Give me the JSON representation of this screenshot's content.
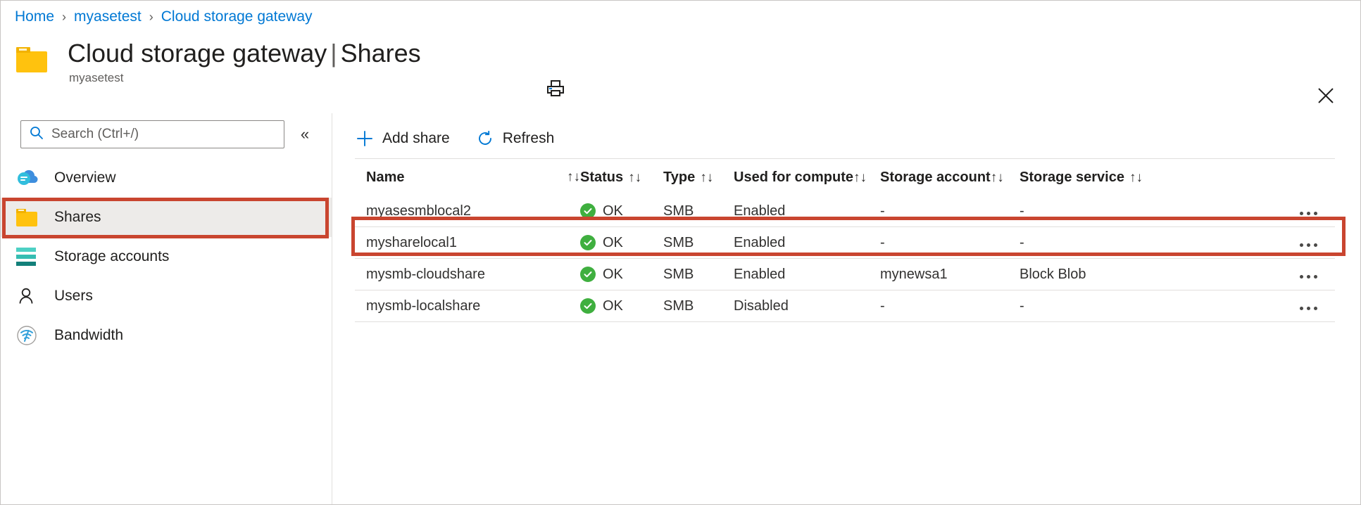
{
  "breadcrumb": {
    "items": [
      {
        "label": "Home"
      },
      {
        "label": "myasetest"
      },
      {
        "label": "Cloud storage gateway"
      }
    ],
    "separator": "›"
  },
  "header": {
    "title": "Cloud storage gateway",
    "title_separator": "|",
    "subtitle_title": "Shares",
    "resource_name": "myasetest",
    "print_icon": "printer-icon",
    "close_icon": "close-icon",
    "resource_icon": "folder-icon"
  },
  "sidebar": {
    "search": {
      "placeholder": "Search (Ctrl+/)",
      "value": "",
      "icon": "search-icon"
    },
    "collapse_label": "«",
    "items": [
      {
        "label": "Overview",
        "icon": "cloud-icon",
        "selected": false
      },
      {
        "label": "Shares",
        "icon": "folder-icon",
        "selected": true
      },
      {
        "label": "Storage accounts",
        "icon": "storage-icon",
        "selected": false
      },
      {
        "label": "Users",
        "icon": "user-icon",
        "selected": false
      },
      {
        "label": "Bandwidth",
        "icon": "bandwidth-icon",
        "selected": false
      }
    ]
  },
  "toolbar": {
    "add_share_label": "Add share",
    "add_share_icon": "plus-icon",
    "refresh_label": "Refresh",
    "refresh_icon": "refresh-icon"
  },
  "table": {
    "sort_icon": "↑↓",
    "columns": [
      {
        "label": "Name",
        "sortable": true
      },
      {
        "label": "Status",
        "sortable": true
      },
      {
        "label": "Type",
        "sortable": true
      },
      {
        "label": "Used for compute",
        "sortable": true
      },
      {
        "label": "Storage account",
        "sortable": true
      },
      {
        "label": "Storage service",
        "sortable": true
      }
    ],
    "rows": [
      {
        "name": "myasesmblocal2",
        "status": "OK",
        "type": "SMB",
        "used_for_compute": "Enabled",
        "storage_account": "-",
        "storage_service": "-",
        "highlighted": true,
        "more_icon": "ellipsis-icon"
      },
      {
        "name": "mysharelocal1",
        "status": "OK",
        "type": "SMB",
        "used_for_compute": "Enabled",
        "storage_account": "-",
        "storage_service": "-",
        "highlighted": false,
        "more_icon": "ellipsis-icon"
      },
      {
        "name": "mysmb-cloudshare",
        "status": "OK",
        "type": "SMB",
        "used_for_compute": "Enabled",
        "storage_account": "mynewsa1",
        "storage_service": "Block Blob",
        "highlighted": false,
        "more_icon": "ellipsis-icon"
      },
      {
        "name": "mysmb-localshare",
        "status": "OK",
        "type": "SMB",
        "used_for_compute": "Disabled",
        "storage_account": "-",
        "storage_service": "-",
        "highlighted": false,
        "more_icon": "ellipsis-icon"
      }
    ]
  },
  "colors": {
    "link": "#0078d4",
    "accent": "#0078d4",
    "status_ok": "#3faf3f",
    "highlight_box": "#c9452f",
    "folder": "#ffc20e",
    "selected_row": "#edebe9"
  }
}
